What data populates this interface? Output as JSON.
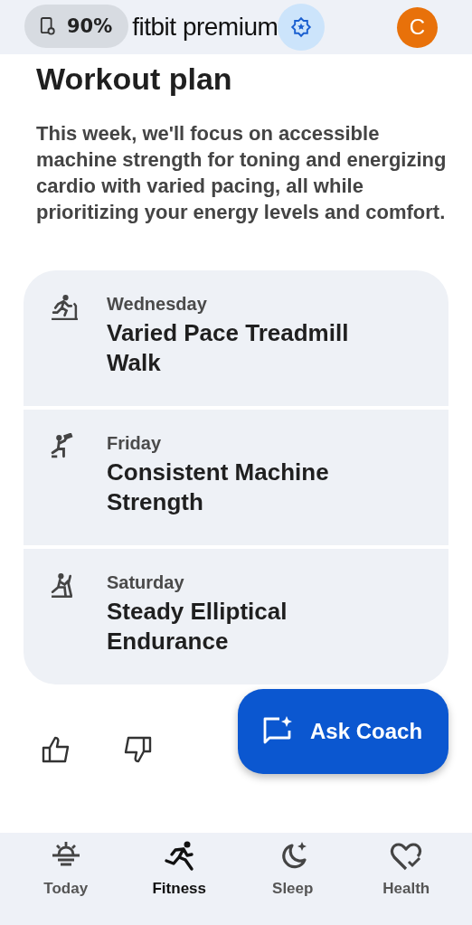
{
  "header": {
    "battery": "90%",
    "title": "fitbit premium",
    "avatar": "C"
  },
  "heading": "Workout plan",
  "summary": "This week, we'll focus on accessible machine strength for toning and energizing cardio with varied pacing, all while prioritizing your energy levels and comfort.",
  "workouts": [
    {
      "kind": "treadmill",
      "day": "Wednesday",
      "title": "Varied Pace Treadmill Walk"
    },
    {
      "kind": "strength",
      "day": "Friday",
      "title": "Consistent Machine Strength"
    },
    {
      "kind": "elliptical",
      "day": "Saturday",
      "title": "Steady Elliptical Endurance"
    }
  ],
  "coach_button": "Ask Coach",
  "nav": [
    {
      "kind": "today",
      "label": "Today",
      "selected": false
    },
    {
      "kind": "fitness",
      "label": "Fitness",
      "selected": true
    },
    {
      "kind": "sleep",
      "label": "Sleep",
      "selected": false
    },
    {
      "kind": "health",
      "label": "Health",
      "selected": false
    }
  ]
}
